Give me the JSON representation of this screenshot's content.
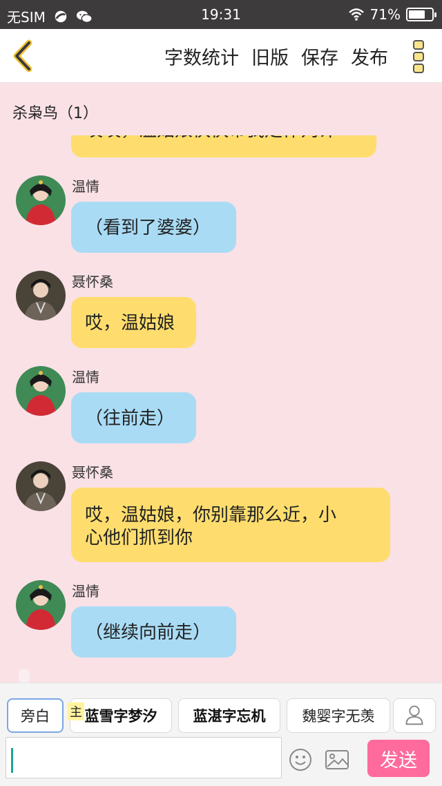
{
  "status_bar": {
    "carrier": "无SIM",
    "time": "19:31",
    "battery": "71%",
    "battery_level": 0.71
  },
  "toolbar": {
    "word_count": "字数统计",
    "old_version": "旧版",
    "save": "保存",
    "publish": "发布"
  },
  "chat": {
    "title": "杀枭鸟（1）",
    "partial_text": "哎哎，温姑娘快快带我走作判计",
    "messages": [
      {
        "name": "温情",
        "text": "（看到了婆婆）",
        "color": "#a9dbf5"
      },
      {
        "name": "聂怀桑",
        "text": "哎，温姑娘",
        "color": "#fedd6e"
      },
      {
        "name": "温情",
        "text": "（往前走）",
        "color": "#a9dbf5"
      },
      {
        "name": "聂怀桑",
        "text_line1": "哎，温姑娘，你别靠那么近，小",
        "text_line2": "心他们抓到你",
        "color": "#fedd6e"
      },
      {
        "name": "温情",
        "text": "（继续向前走）",
        "color": "#a9dbf5"
      }
    ]
  },
  "roles": {
    "narrator": "旁白",
    "host_tag": "主",
    "role1": "蓝雪字梦汐",
    "role2": "蓝湛字忘机",
    "role3": "魏婴字无羡"
  },
  "input": {
    "send": "发送"
  },
  "colors": {
    "background": "#f9e1e6",
    "send_button": "#ff6b9c",
    "blue_bubble": "#a9dbf5",
    "yellow_bubble": "#fedd6e",
    "caret": "#1aa39a"
  }
}
